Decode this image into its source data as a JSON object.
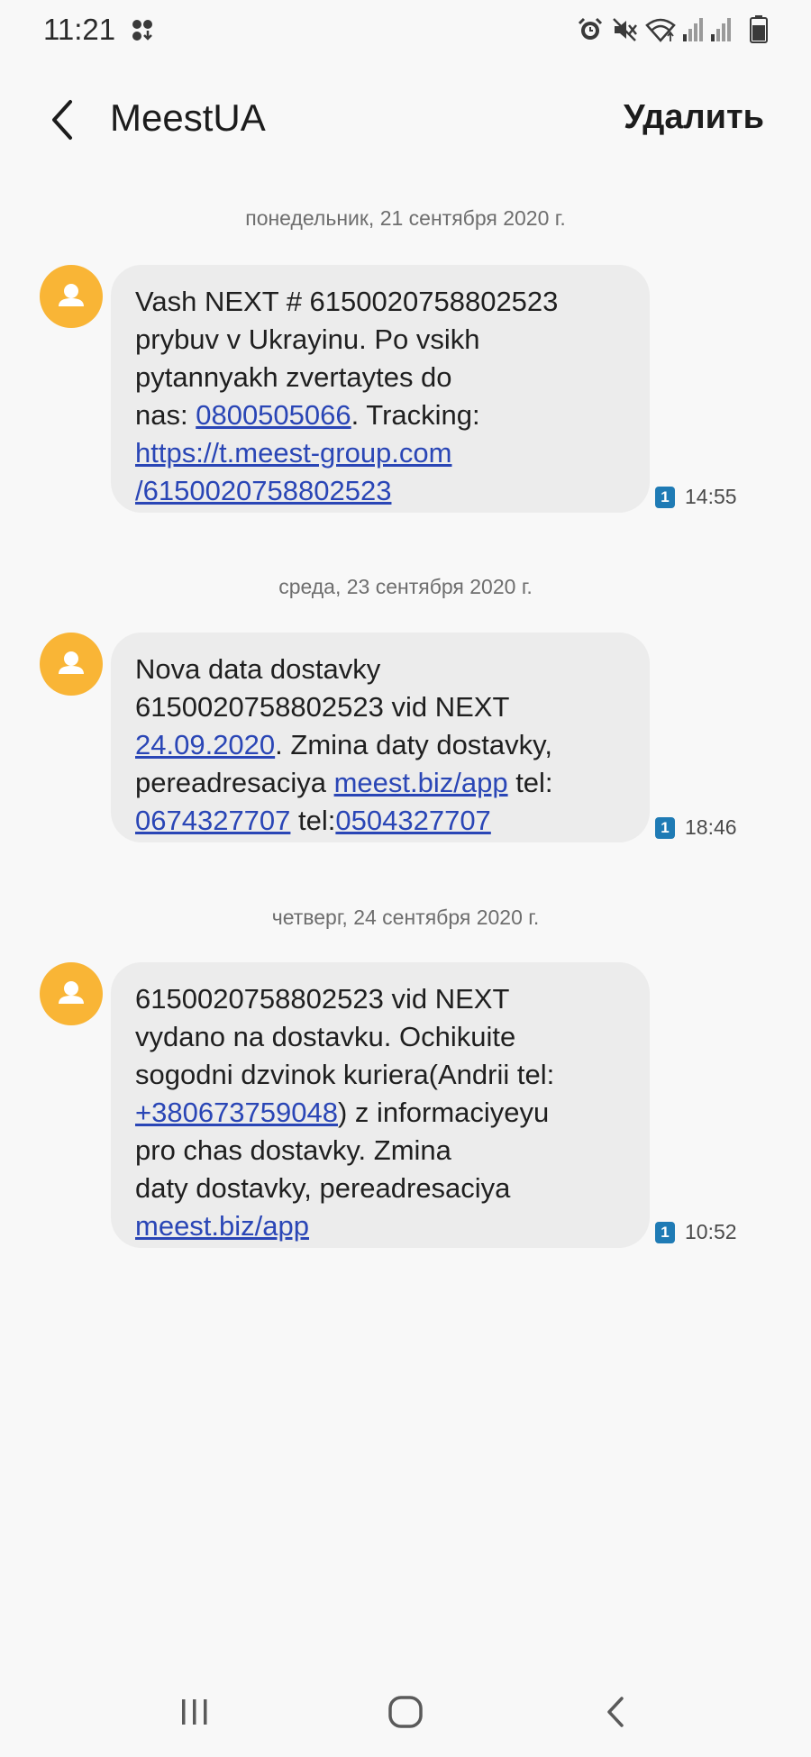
{
  "status_bar": {
    "time": "11:21",
    "icons": [
      "dual-app-icon",
      "alarm-icon",
      "mute-icon",
      "wifi-icon",
      "signal-icon",
      "signal-icon",
      "battery-icon"
    ]
  },
  "header": {
    "back_icon": "chevron-left-icon",
    "title": "MeestUA",
    "delete_label": "Удалить"
  },
  "conversation": [
    {
      "date": "понедельник, 21 сентября 2020 г.",
      "sim": "1",
      "time": "14:55",
      "parts": [
        {
          "text": "Vash NEXT # 6150020758802523\nprybuv v Ukrayinu. Po vsikh\npytannyakh zvertaytes do\nnas: "
        },
        {
          "text": "0800505066",
          "link": true
        },
        {
          "text": ". Tracking:\n"
        },
        {
          "text": "https://t.meest-group.com\n/6150020758802523",
          "link": true
        }
      ]
    },
    {
      "date": "среда, 23 сентября 2020 г.",
      "sim": "1",
      "time": "18:46",
      "parts": [
        {
          "text": "Nova data dostavky\n6150020758802523 vid NEXT\n"
        },
        {
          "text": "24.09.2020",
          "link": true
        },
        {
          "text": ". Zmina daty dostavky,\npereadresaciya "
        },
        {
          "text": "meest.biz/app",
          "link": true
        },
        {
          "text": " tel:\n"
        },
        {
          "text": "0674327707",
          "link": true
        },
        {
          "text": " tel:"
        },
        {
          "text": "0504327707",
          "link": true
        }
      ]
    },
    {
      "date": "четверг, 24 сентября 2020 г.",
      "sim": "1",
      "time": "10:52",
      "parts": [
        {
          "text": "6150020758802523 vid NEXT\nvydano na dostavku. Ochikuite\nsogodni dzvinok kuriera(Andrii tel:\n"
        },
        {
          "text": "+380673759048",
          "link": true
        },
        {
          "text": ") z informaciyeyu\npro chas dostavky. Zmina\ndaty dostavky, pereadresaciya\n"
        },
        {
          "text": "meest.biz/app",
          "link": true
        }
      ]
    }
  ],
  "nav_bar": {
    "icons": [
      "recent-apps-icon",
      "home-icon",
      "back-icon"
    ]
  },
  "colors": {
    "background": "#f8f8f8",
    "bubble": "#ececec",
    "link": "#2a46b6",
    "avatar": "#f9b536",
    "sim_badge": "#1f7bb5"
  }
}
